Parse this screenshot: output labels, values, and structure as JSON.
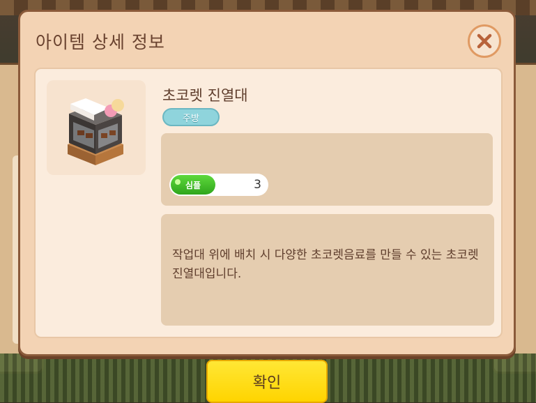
{
  "dialog": {
    "title": "아이템 상세 정보",
    "close_icon": "close-icon"
  },
  "item": {
    "name": "초코렛 진열대",
    "category": "주방",
    "thumbnail_icon": "chocolate-display-case-icon",
    "stats": [
      {
        "label": "심플",
        "value": "3"
      }
    ],
    "description": "작업대 위에 배치 시 다양한 초코렛음료를 만들 수 있는 초코렛 진열대입니다."
  },
  "actions": {
    "confirm_label": "확인"
  },
  "colors": {
    "dialog_bg": "#f3d3b4",
    "badge": "#8fd4dc",
    "stat_green": "#3cbf24",
    "confirm_yellow": "#ffe000"
  }
}
